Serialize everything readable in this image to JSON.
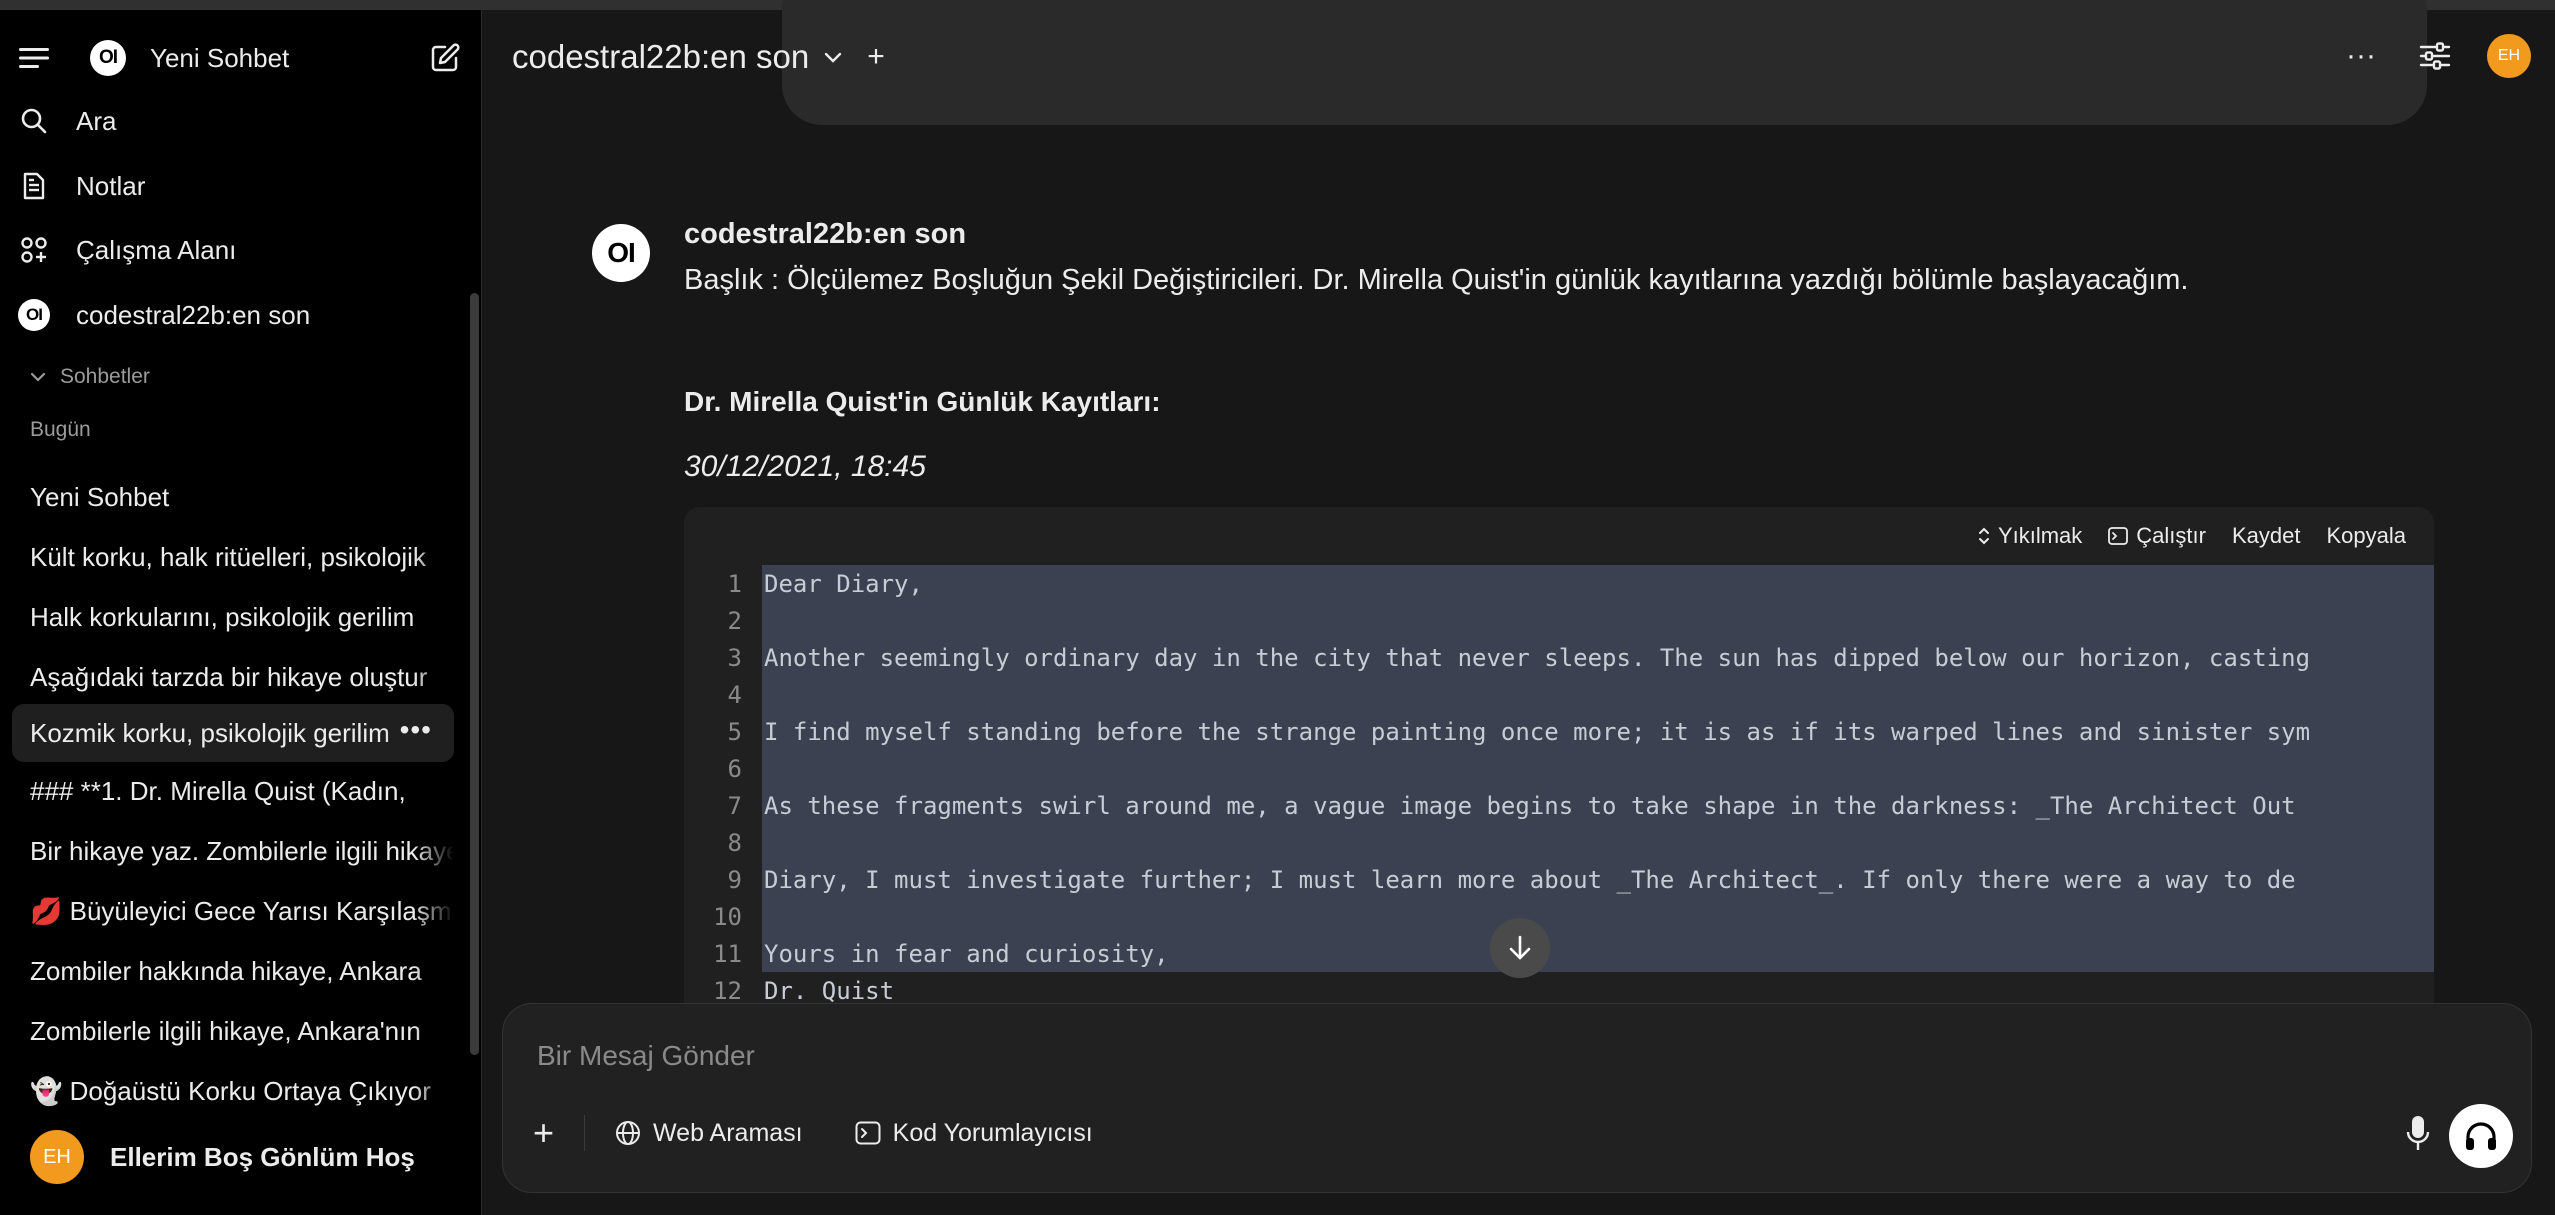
{
  "sidebar": {
    "new_chat_label": "Yeni Sohbet",
    "logo_text": "OI",
    "nav": [
      {
        "label": "Ara",
        "icon": "search-icon"
      },
      {
        "label": "Notlar",
        "icon": "notes-icon"
      },
      {
        "label": "Çalışma Alanı",
        "icon": "workspace-icon"
      },
      {
        "label": "codestral22b:en son",
        "icon": "model-logo-icon"
      }
    ],
    "chats_section": "Sohbetler",
    "today_label": "Bugün",
    "chats": [
      "Yeni Sohbet",
      "Kült korku, halk ritüelleri, psikolojik",
      "Halk korkularını, psikolojik gerilim",
      "Aşağıdaki tarzda bir hikaye oluştur",
      "Kozmik korku, psikolojik gerilim",
      "### **1. Dr. Mirella Quist (Kadın,",
      "Bir hikaye yaz. Zombilerle ilgili hikaye",
      "💋 Büyüleyici Gece Yarısı Karşılaşması",
      "Zombiler hakkında hikaye, Ankara",
      "Zombilerle ilgili hikaye, Ankara'nın",
      "👻 Doğaüstü Korku Ortaya Çıkıyor"
    ],
    "active_chat_index": 4,
    "active_chat_menu": "•••",
    "user": {
      "initials": "EH",
      "name": "Ellerim Boş Gönlüm Hoş"
    }
  },
  "header": {
    "model_name": "codestral22b:en son",
    "add_label": "+",
    "more_label": "···",
    "user_initials": "EH"
  },
  "message": {
    "author": "codestral22b:en son",
    "logo_text": "OI",
    "intro": "Başlık : Ölçülemez Boşluğun Şekil Değiştiricileri. Dr. Mirella Quist'in günlük kayıtlarına yazdığı bölümle başlayacağım.",
    "heading": "Dr. Mirella Quist'in Günlük Kayıtları:",
    "date": "30/12/2021, 18:45"
  },
  "code": {
    "toolbar": {
      "collapse": "Yıkılmak",
      "run": "Çalıştır",
      "save": "Kaydet",
      "copy": "Kopyala"
    },
    "lines": [
      {
        "n": "1",
        "text": "Dear Diary,"
      },
      {
        "n": "2",
        "text": ""
      },
      {
        "n": "3",
        "text": "Another seemingly ordinary day in the city that never sleeps. The sun has dipped below our horizon, casting"
      },
      {
        "n": "4",
        "text": ""
      },
      {
        "n": "5",
        "text": "I find myself standing before the strange painting once more; it is as if its warped lines and sinister sym"
      },
      {
        "n": "6",
        "text": ""
      },
      {
        "n": "7",
        "text": "As these fragments swirl around me, a vague image begins to take shape in the darkness: _The Architect Out"
      },
      {
        "n": "8",
        "text": ""
      },
      {
        "n": "9",
        "text": "Diary, I must investigate further; I must learn more about _The Architect_. If only there were a way to de"
      },
      {
        "n": "10",
        "text": ""
      },
      {
        "n": "11",
        "text": "Yours in fear and curiosity,"
      },
      {
        "n": "12",
        "text": "Dr. Quist"
      }
    ]
  },
  "composer": {
    "placeholder": "Bir Mesaj Gönder",
    "plus_label": "+",
    "web_search": "Web Araması",
    "code_interpreter": "Kod Yorumlayıcısı"
  },
  "colors": {
    "sidebar_bg": "#000000",
    "main_bg": "#171717",
    "avatar": "#f19a1d",
    "code_selection": "#3b4150"
  }
}
